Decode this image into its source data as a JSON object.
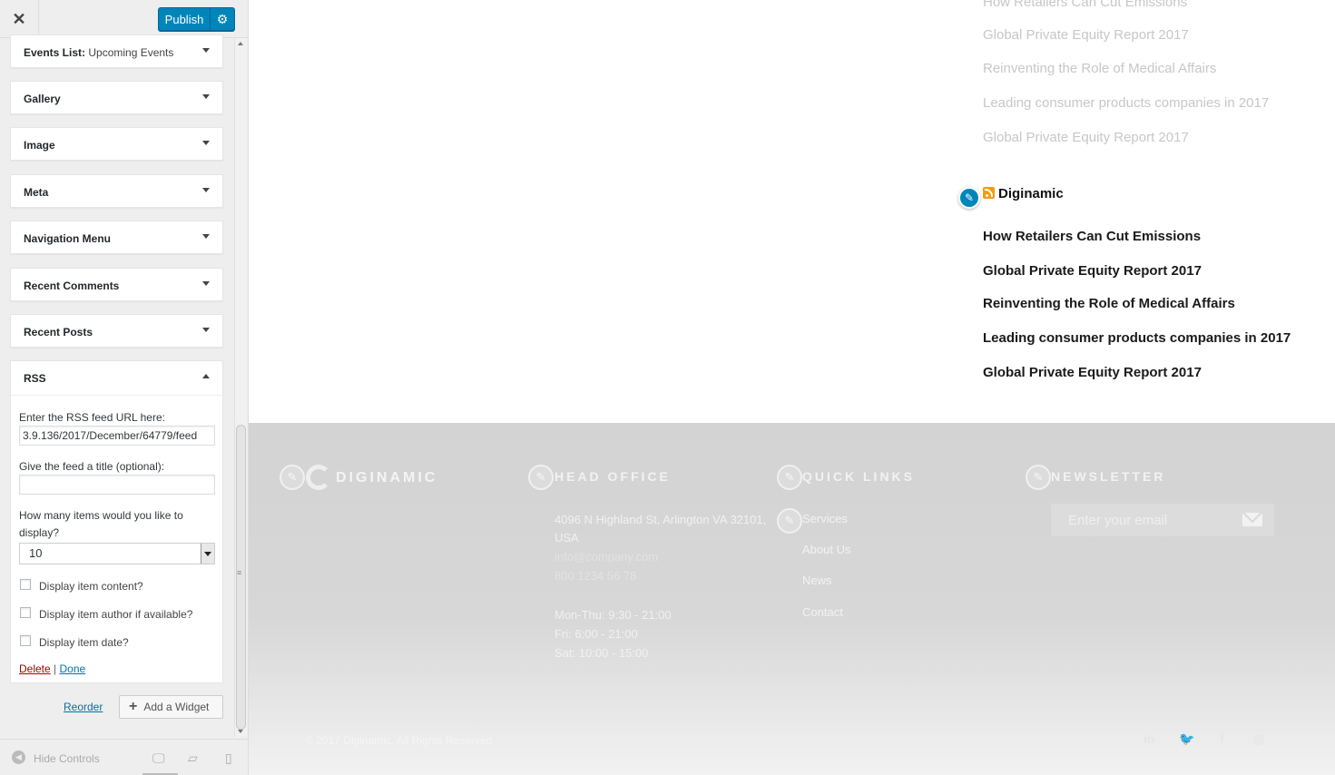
{
  "sidebar": {
    "close_icon": "close-icon",
    "publish_label": "Publish",
    "settings_icon": "gear-icon",
    "widgets": [
      {
        "label": "Events List:",
        "sub": " Upcoming Events"
      },
      {
        "label": "Gallery"
      },
      {
        "label": "Image"
      },
      {
        "label": "Meta"
      },
      {
        "label": "Navigation Menu"
      },
      {
        "label": "Recent Comments"
      },
      {
        "label": "Recent Posts"
      },
      {
        "label": "RSS"
      }
    ],
    "rss_form": {
      "url_label": "Enter the RSS feed URL here:",
      "url_value": "3.9.136/2017/December/64779/feed",
      "title_label": "Give the feed a title (optional):",
      "title_value": "",
      "count_label": "How many items would you like to display?",
      "count_value": "10",
      "show_content_label": "Display item content?",
      "show_author_label": "Display item author if available?",
      "show_date_label": "Display item date?",
      "delete_label": "Delete",
      "separator": "|",
      "done_label": "Done"
    },
    "reorder_label": "Reorder",
    "add_widget_label": "Add a Widget",
    "footer": {
      "hide_controls_label": "Hide Controls",
      "devices": [
        "desktop-icon",
        "tablet-icon",
        "mobile-icon"
      ]
    }
  },
  "preview": {
    "faded_links": [
      "How Retailers Can Cut Emissions",
      "Global Private Equity Report 2017",
      "Reinventing the Role of Medical Affairs",
      "Leading consumer products companies in 2017",
      "Global Private Equity Report 2017"
    ],
    "rss_widget": {
      "title": "Diginamic",
      "items": [
        "How Retailers Can Cut Emissions",
        "Global Private Equity Report 2017",
        "Reinventing the Role of Medical Affairs",
        "Leading consumer products companies in 2017",
        "Global Private Equity Report 2017"
      ]
    },
    "footer": {
      "logo_text": "DIGINAMIC",
      "head_office_heading": "HEAD OFFICE",
      "address_line1": "4096 N Highland St, Arlington VA 32101,",
      "address_line2": "USA",
      "email": "info@company.com",
      "phone": "800 1234 56 78",
      "hours": [
        "Mon-Thu: 9:30 - 21:00",
        "Fri: 6:00 - 21:00",
        "Sat: 10:00 - 15:00"
      ],
      "quick_links_heading": "QUICK LINKS",
      "quick_links": [
        "Services",
        "About Us",
        "News",
        "Contact"
      ],
      "newsletter_heading": "NEWSLETTER",
      "newsletter_placeholder": "Enter your email",
      "copyright": "© 2017 Diginamic. All Rights Reserved",
      "social": [
        "linkedin-icon",
        "twitter-icon",
        "facebook-icon",
        "instagram-icon"
      ]
    }
  },
  "colors": {
    "accent": "#0085ba",
    "link": "#0073aa",
    "delete": "#a00",
    "rss": "#f39c12"
  }
}
